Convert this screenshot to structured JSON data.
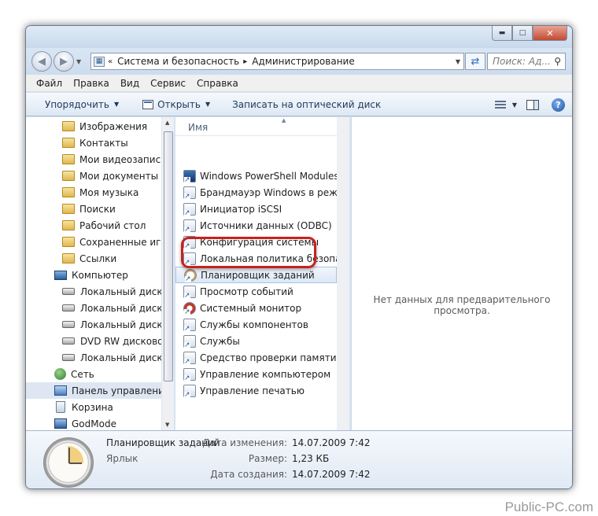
{
  "window": {
    "caption_buttons": [
      "▬",
      "□",
      "✕"
    ]
  },
  "address_bar": {
    "crumbs": [
      "Система и безопасность",
      "Администрирование"
    ],
    "prefix": "«",
    "separator": "▸",
    "search_placeholder": "Поиск: Ад..."
  },
  "menu": [
    "Файл",
    "Правка",
    "Вид",
    "Сервис",
    "Справка"
  ],
  "toolbar": {
    "organize": "Упорядочить",
    "open": "Открыть",
    "burn": "Записать на оптический диск"
  },
  "nav_pane": {
    "items": [
      {
        "label": "Изображения",
        "icon": "folder-icon"
      },
      {
        "label": "Контакты",
        "icon": "folder-icon"
      },
      {
        "label": "Мои видеозаписи",
        "icon": "folder-icon"
      },
      {
        "label": "Мои документы",
        "icon": "folder-icon"
      },
      {
        "label": "Моя музыка",
        "icon": "folder-icon"
      },
      {
        "label": "Поиски",
        "icon": "folder-icon"
      },
      {
        "label": "Рабочий стол",
        "icon": "folder-icon"
      },
      {
        "label": "Сохраненные игры",
        "icon": "folder-icon"
      },
      {
        "label": "Ссылки",
        "icon": "folder-icon"
      },
      {
        "label": "Компьютер",
        "icon": "computer-icon"
      },
      {
        "label": "Локальный диск (C:)",
        "icon": "drive-icon"
      },
      {
        "label": "Локальный диск (D:)",
        "icon": "drive-icon"
      },
      {
        "label": "Локальный диск (E:)",
        "icon": "drive-icon"
      },
      {
        "label": "DVD RW дисковод (F:)",
        "icon": "drive-icon"
      },
      {
        "label": "Локальный диск (Y:)",
        "icon": "drive-icon"
      },
      {
        "label": "Сеть",
        "icon": "network-icon"
      },
      {
        "label": "Панель управления",
        "icon": "control-panel-icon",
        "selected": true
      },
      {
        "label": "Корзина",
        "icon": "recycle-bin-icon"
      },
      {
        "label": "GodMode",
        "icon": "godmode-icon"
      }
    ]
  },
  "file_list": {
    "column_name": "Имя",
    "items": [
      {
        "label": "Windows PowerShell Modules",
        "icon": "powershell-icon"
      },
      {
        "label": "Брандмауэр Windows в режиме повышенной безопасности",
        "icon": "firewall-icon"
      },
      {
        "label": "Инициатор iSCSI",
        "icon": "iscsi-icon"
      },
      {
        "label": "Источники данных (ODBC)",
        "icon": "odbc-icon"
      },
      {
        "label": "Конфигурация системы",
        "icon": "msconfig-icon"
      },
      {
        "label": "Локальная политика безопасности",
        "icon": "security-policy-icon"
      },
      {
        "label": "Планировщик заданий",
        "icon": "task-scheduler-icon",
        "selected": true
      },
      {
        "label": "Просмотр событий",
        "icon": "event-viewer-icon"
      },
      {
        "label": "Системный монитор",
        "icon": "perfmon-icon"
      },
      {
        "label": "Службы компонентов",
        "icon": "component-services-icon"
      },
      {
        "label": "Службы",
        "icon": "services-icon"
      },
      {
        "label": "Средство проверки памяти Windows",
        "icon": "memory-diagnostic-icon"
      },
      {
        "label": "Управление компьютером",
        "icon": "computer-management-icon"
      },
      {
        "label": "Управление печатью",
        "icon": "print-management-icon"
      }
    ]
  },
  "preview": {
    "message": "Нет данных для предварительного просмотра."
  },
  "details": {
    "name": "Планировщик заданий",
    "type": "Ярлык",
    "modified_label": "Дата изменения:",
    "modified_value": "14.07.2009 7:42",
    "size_label": "Размер:",
    "size_value": "1,23 КБ",
    "created_label": "Дата создания:",
    "created_value": "14.07.2009 7:42"
  },
  "watermark": "Public-PC.com",
  "colors": {
    "highlight_ring": "#c8221f",
    "selection": "#dbe8f7",
    "frame": "#d6e3f1"
  }
}
